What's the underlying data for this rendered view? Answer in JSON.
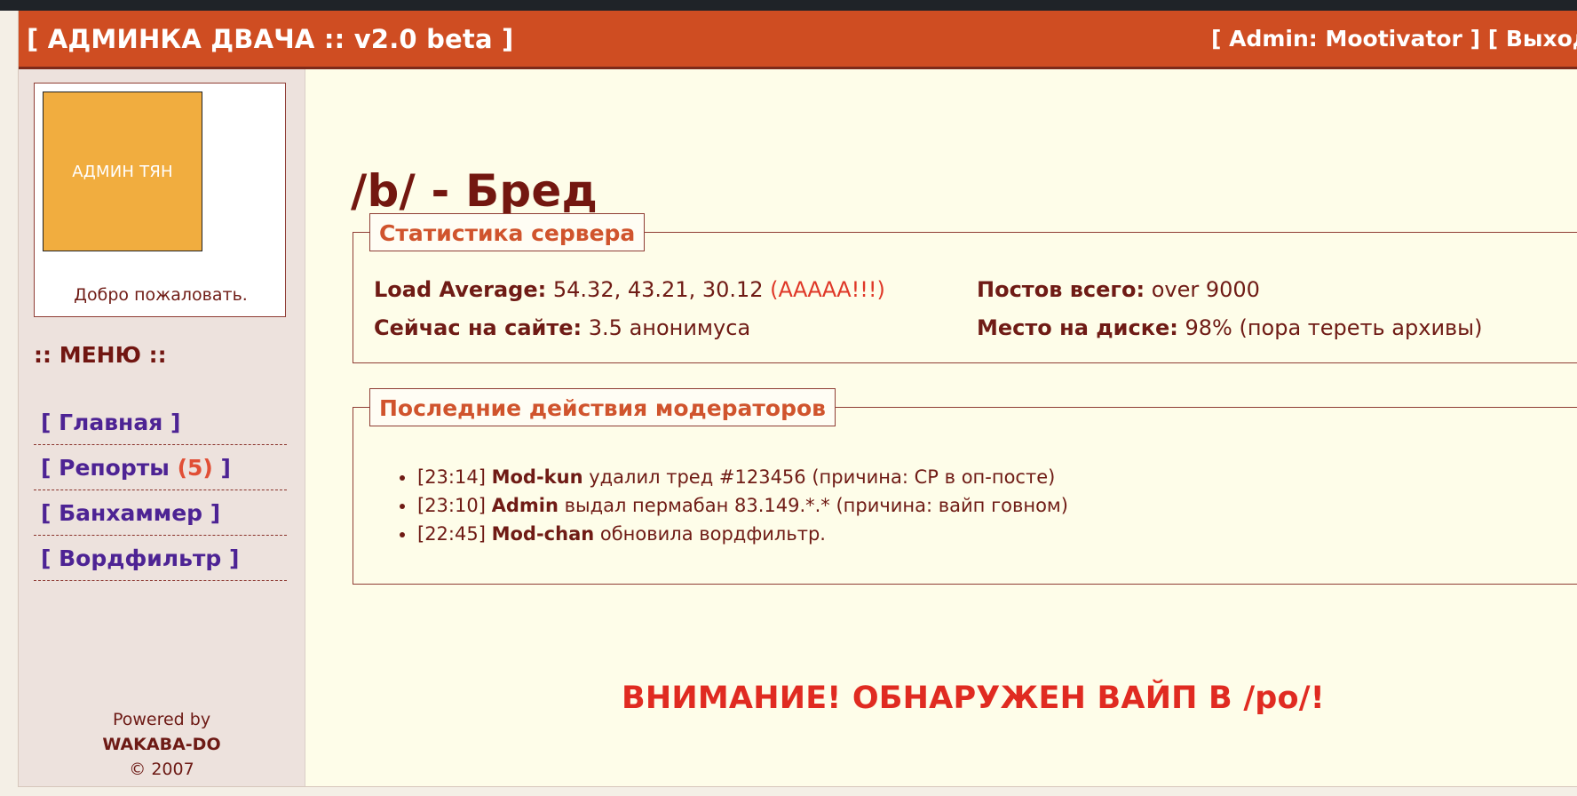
{
  "header": {
    "title": "[ АДМИНКА ДВАЧА :: v2.0 beta ]",
    "admin_link": "[ Admin: Mootivator ]",
    "logout_link": "[ Выход ]"
  },
  "sidebar": {
    "avatar_text": "АДМИН ТЯН",
    "welcome": "Добро пожаловать.",
    "menu_heading": ":: МЕНЮ ::",
    "items": [
      {
        "label": "[ Главная ]"
      },
      {
        "label_before": "[ Репорты ",
        "count": "(5)",
        "label_after": " ]"
      },
      {
        "label": "[ Банхаммер ]"
      },
      {
        "label": "[ Вордфильтр ]"
      }
    ],
    "powered_by": "Powered by",
    "brand": "WAKABA-DO",
    "copyright": "© 2007"
  },
  "main": {
    "board_title": "/b/ - Бред",
    "stats": {
      "legend": "Статистика сервера",
      "load": {
        "label": "Load Average:",
        "value": "54.32, 43.21, 30.12",
        "alert": "(ААААА!!!)"
      },
      "online": {
        "label": "Сейчас на сайте:",
        "value": "3.5 анонимуса"
      },
      "posts": {
        "label": "Постов всего:",
        "value": "over 9000"
      },
      "disk": {
        "label": "Место на диске:",
        "value": "98% (пора тереть архивы)"
      }
    },
    "moderator_actions": {
      "legend": "Последние действия модераторов",
      "items": [
        {
          "time": "[23:14]",
          "user": "Mod-kun",
          "text": "удалил тред #123456 (причина: CP в оп-посте)"
        },
        {
          "time": "[23:10]",
          "user": "Admin",
          "text": "выдал пермабан 83.149.*.* (причина: вайп говном)"
        },
        {
          "time": "[22:45]",
          "user": "Mod-chan",
          "text": "обновила вордфильтр."
        }
      ]
    },
    "alert": "ВНИМАНИЕ! ОБНАРУЖЕН ВАЙП В /po/!"
  },
  "colors": {
    "header_bg": "#cf4d22",
    "sidebar_bg": "#ede2dd",
    "content_bg": "#fefde9",
    "text_dark_red": "#6f1b15",
    "legend_orange": "#d0542d",
    "menu_purple": "#4d2394",
    "alert_red": "#e02b21",
    "avatar_orange": "#f1ad3f"
  }
}
